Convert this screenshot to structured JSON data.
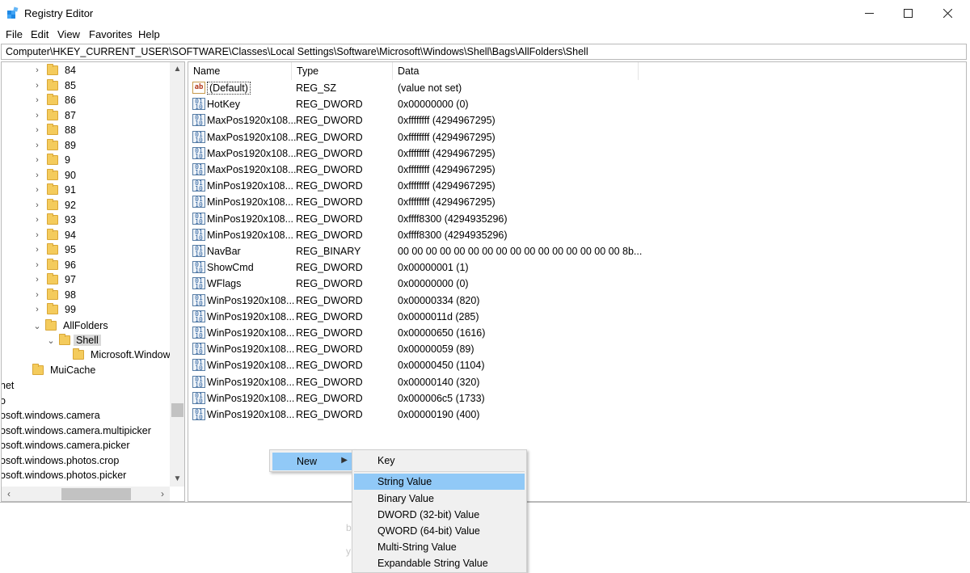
{
  "window": {
    "title": "Registry Editor"
  },
  "menu": [
    "File",
    "Edit",
    "View",
    "Favorites",
    "Help"
  ],
  "address": "Computer\\HKEY_CURRENT_USER\\SOFTWARE\\Classes\\Local Settings\\Software\\Microsoft\\Windows\\Shell\\Bags\\AllFolders\\Shell",
  "tree": {
    "numbered": [
      "84",
      "85",
      "86",
      "87",
      "88",
      "89",
      "9",
      "90",
      "91",
      "92",
      "93",
      "94",
      "95",
      "96",
      "97",
      "98",
      "99"
    ],
    "allfolders": "AllFolders",
    "shell": "Shell",
    "microsoft_window": "Microsoft.Window",
    "muicache": "MuiCache",
    "truncated": [
      "net",
      "o",
      "osoft.windows.camera",
      "osoft.windows.camera.multipicker",
      "osoft.windows.camera.picker",
      "osoft.windows.photos.crop",
      "osoft.windows.photos.picker"
    ]
  },
  "list": {
    "columns": {
      "name": "Name",
      "type": "Type",
      "data": "Data"
    },
    "rows": [
      {
        "name": "(Default)",
        "type": "REG_SZ",
        "data": "(value not set)",
        "icon": "string-value-icon"
      },
      {
        "name": "HotKey",
        "type": "REG_DWORD",
        "data": "0x00000000 (0)",
        "icon": "binary-value-icon"
      },
      {
        "name": "MaxPos1920x108...",
        "type": "REG_DWORD",
        "data": "0xffffffff (4294967295)",
        "icon": "binary-value-icon"
      },
      {
        "name": "MaxPos1920x108...",
        "type": "REG_DWORD",
        "data": "0xffffffff (4294967295)",
        "icon": "binary-value-icon"
      },
      {
        "name": "MaxPos1920x108...",
        "type": "REG_DWORD",
        "data": "0xffffffff (4294967295)",
        "icon": "binary-value-icon"
      },
      {
        "name": "MaxPos1920x108...",
        "type": "REG_DWORD",
        "data": "0xffffffff (4294967295)",
        "icon": "binary-value-icon"
      },
      {
        "name": "MinPos1920x108...",
        "type": "REG_DWORD",
        "data": "0xffffffff (4294967295)",
        "icon": "binary-value-icon"
      },
      {
        "name": "MinPos1920x108...",
        "type": "REG_DWORD",
        "data": "0xffffffff (4294967295)",
        "icon": "binary-value-icon"
      },
      {
        "name": "MinPos1920x108...",
        "type": "REG_DWORD",
        "data": "0xffff8300 (4294935296)",
        "icon": "binary-value-icon"
      },
      {
        "name": "MinPos1920x108...",
        "type": "REG_DWORD",
        "data": "0xffff8300 (4294935296)",
        "icon": "binary-value-icon"
      },
      {
        "name": "NavBar",
        "type": "REG_BINARY",
        "data": "00 00 00 00 00 00 00 00 00 00 00 00 00 00 00 00 8b...",
        "icon": "binary-value-icon"
      },
      {
        "name": "ShowCmd",
        "type": "REG_DWORD",
        "data": "0x00000001 (1)",
        "icon": "binary-value-icon"
      },
      {
        "name": "WFlags",
        "type": "REG_DWORD",
        "data": "0x00000000 (0)",
        "icon": "binary-value-icon"
      },
      {
        "name": "WinPos1920x108...",
        "type": "REG_DWORD",
        "data": "0x00000334 (820)",
        "icon": "binary-value-icon"
      },
      {
        "name": "WinPos1920x108...",
        "type": "REG_DWORD",
        "data": "0x0000011d (285)",
        "icon": "binary-value-icon"
      },
      {
        "name": "WinPos1920x108...",
        "type": "REG_DWORD",
        "data": "0x00000650 (1616)",
        "icon": "binary-value-icon"
      },
      {
        "name": "WinPos1920x108...",
        "type": "REG_DWORD",
        "data": "0x00000059 (89)",
        "icon": "binary-value-icon"
      },
      {
        "name": "WinPos1920x108...",
        "type": "REG_DWORD",
        "data": "0x00000450 (1104)",
        "icon": "binary-value-icon"
      },
      {
        "name": "WinPos1920x108...",
        "type": "REG_DWORD",
        "data": "0x00000140 (320)",
        "icon": "binary-value-icon"
      },
      {
        "name": "WinPos1920x108...",
        "type": "REG_DWORD",
        "data": "0x000006c5 (1733)",
        "icon": "binary-value-icon"
      },
      {
        "name": "WinPos1920x108...",
        "type": "REG_DWORD",
        "data": "0x00000190 (400)",
        "icon": "binary-value-icon"
      }
    ]
  },
  "context_menu": {
    "new_label": "New",
    "submenu": [
      "Key",
      "String Value",
      "Binary Value",
      "DWORD (32-bit) Value",
      "QWORD (64-bit) Value",
      "Multi-String Value",
      "Expandable String Value"
    ],
    "highlighted": "String Value"
  }
}
